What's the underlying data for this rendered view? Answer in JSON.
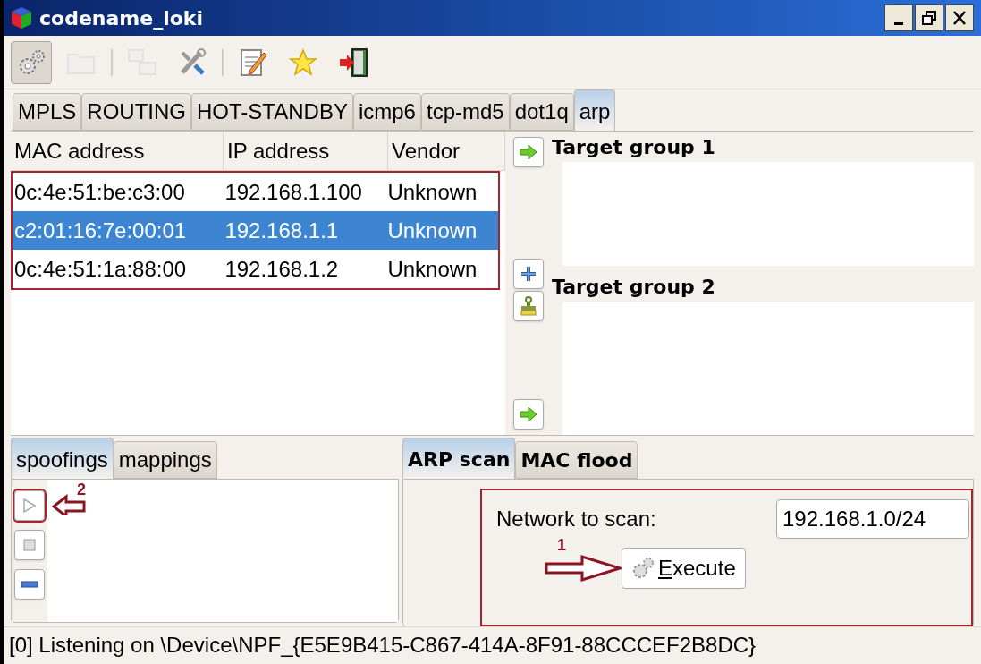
{
  "window": {
    "title": "codename_loki"
  },
  "toolbar": [
    {
      "kind": "gears",
      "selected": true,
      "disabled": false
    },
    {
      "kind": "folder",
      "selected": false,
      "disabled": true
    },
    {
      "kind": "separator"
    },
    {
      "kind": "network",
      "selected": false,
      "disabled": true
    },
    {
      "kind": "tools",
      "selected": false,
      "disabled": false
    },
    {
      "kind": "separator"
    },
    {
      "kind": "edit",
      "selected": false,
      "disabled": false
    },
    {
      "kind": "star",
      "selected": false,
      "disabled": false
    },
    {
      "kind": "exit",
      "selected": false,
      "disabled": false
    }
  ],
  "tabs": [
    {
      "label": "MPLS",
      "selected": false
    },
    {
      "label": "ROUTING",
      "selected": false
    },
    {
      "label": "HOT-STANDBY",
      "selected": false
    },
    {
      "label": "icmp6",
      "selected": false
    },
    {
      "label": "tcp-md5",
      "selected": false
    },
    {
      "label": "dot1q",
      "selected": false
    },
    {
      "label": "arp",
      "selected": true
    }
  ],
  "hosts_table": {
    "columns": [
      "MAC address",
      "IP address",
      "Vendor"
    ],
    "rows": [
      {
        "cells": [
          "0c:4e:51:be:c3:00",
          "192.168.1.100",
          "Unknown"
        ],
        "selected": false
      },
      {
        "cells": [
          "c2:01:16:7e:00:01",
          "192.168.1.1",
          "Unknown"
        ],
        "selected": true
      },
      {
        "cells": [
          "0c:4e:51:1a:88:00",
          "192.168.1.2",
          "Unknown"
        ],
        "selected": false
      }
    ]
  },
  "target_groups": [
    {
      "title": "Target group 1"
    },
    {
      "title": "Target group 2"
    }
  ],
  "lower_left_tabs": [
    {
      "label": "spoofings",
      "selected": true
    },
    {
      "label": "mappings",
      "selected": false
    }
  ],
  "spoof_buttons": [
    {
      "kind": "play",
      "annotation": "2"
    },
    {
      "kind": "stop"
    },
    {
      "kind": "remove"
    }
  ],
  "lower_right_tabs": [
    {
      "label": "ARP scan",
      "selected": true
    },
    {
      "label": "MAC flood",
      "selected": false
    }
  ],
  "scan": {
    "label": "Network to scan:",
    "value": "192.168.1.0/24",
    "button": "Execute",
    "annotation": "1"
  },
  "status_bar": "[0] Listening on \\Device\\NPF_{E5E9B415-C867-414A-8F91-88CCCEF2B8DC}"
}
